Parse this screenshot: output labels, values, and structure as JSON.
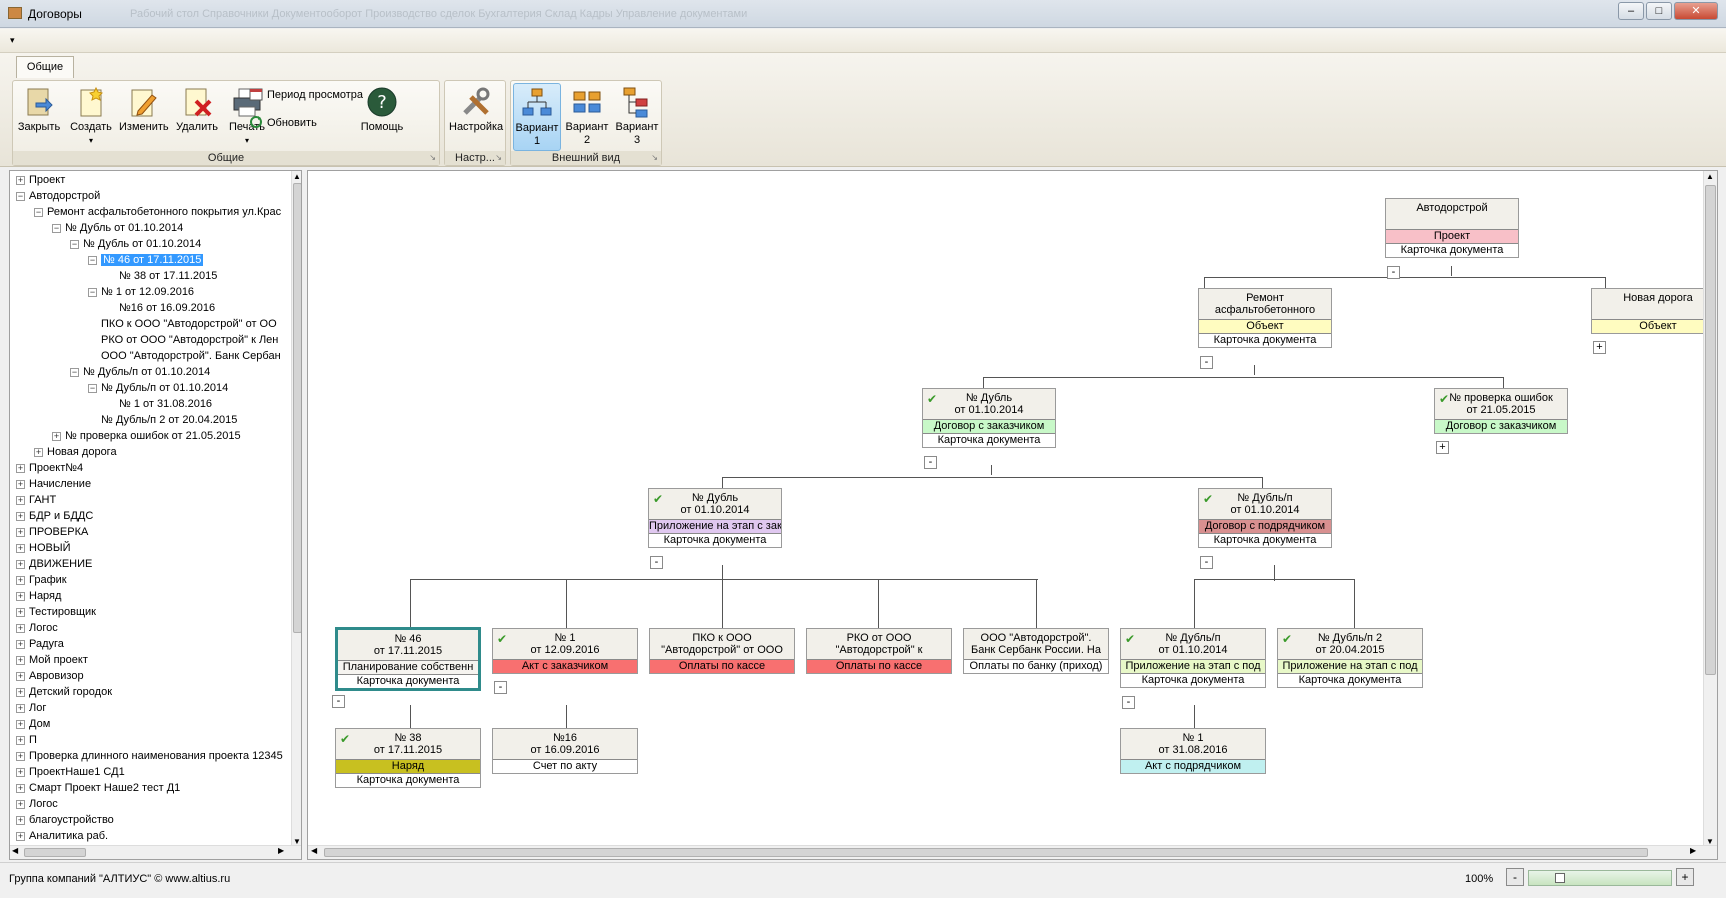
{
  "window": {
    "title": "Договоры",
    "ghost_tabs": "Рабочий стол   Справочники   Документооборот   Производство сделок   Бухгалтерия   Склад   Кадры   Управление документами"
  },
  "ribbon": {
    "tab": "Общие",
    "buttons": {
      "close": "Закрыть",
      "create": "Создать",
      "edit": "Изменить",
      "delete": "Удалить",
      "print": "Печать",
      "period": "Период просмотра",
      "refresh": "Обновить",
      "help": "Помощь",
      "settings": "Настройка",
      "variant1": "Вариант 1",
      "variant2": "Вариант 2",
      "variant3": "Вариант 3"
    },
    "groups": {
      "general": "Общие",
      "settings": "Настр...",
      "appearance": "Внешний вид"
    }
  },
  "tree": [
    {
      "label": "Проект",
      "depth": 0,
      "toggle": "+"
    },
    {
      "label": "Автодорстрой",
      "depth": 0,
      "toggle": "-"
    },
    {
      "label": "Ремонт асфальтобетонного покрытия ул.Крас",
      "depth": 1,
      "toggle": "-"
    },
    {
      "label": "№ Дубль  от 01.10.2014",
      "depth": 2,
      "toggle": "-"
    },
    {
      "label": "№ Дубль  от 01.10.2014",
      "depth": 3,
      "toggle": "-"
    },
    {
      "label": "№ 46  от 17.11.2015",
      "depth": 4,
      "toggle": "-",
      "selected": true
    },
    {
      "label": "№ 38 от 17.11.2015",
      "depth": 5,
      "toggle": ""
    },
    {
      "label": "№ 1 от 12.09.2016",
      "depth": 4,
      "toggle": "-"
    },
    {
      "label": "№16 от 16.09.2016",
      "depth": 5,
      "toggle": ""
    },
    {
      "label": "ПКО к ООО \"Автодорстрой\" от ОО",
      "depth": 4,
      "toggle": ""
    },
    {
      "label": "РКО от ООО \"Автодорстрой\" к Лен",
      "depth": 4,
      "toggle": ""
    },
    {
      "label": "ООО \"Автодорстрой\". Банк Сербан",
      "depth": 4,
      "toggle": ""
    },
    {
      "label": "№ Дубль/п  от 01.10.2014",
      "depth": 3,
      "toggle": "-"
    },
    {
      "label": "№ Дубль/п  от 01.10.2014",
      "depth": 4,
      "toggle": "-"
    },
    {
      "label": "№ 1 от 31.08.2016",
      "depth": 5,
      "toggle": ""
    },
    {
      "label": "№ Дубль/п 2  от 20.04.2015",
      "depth": 4,
      "toggle": ""
    },
    {
      "label": "№ проверка ошибок  от 21.05.2015",
      "depth": 2,
      "toggle": "+"
    },
    {
      "label": "Новая дорога",
      "depth": 1,
      "toggle": "+"
    },
    {
      "label": "Проект№4",
      "depth": 0,
      "toggle": "+"
    },
    {
      "label": "Начисление",
      "depth": 0,
      "toggle": "+"
    },
    {
      "label": "ГАНТ",
      "depth": 0,
      "toggle": "+"
    },
    {
      "label": "БДР и БДДС",
      "depth": 0,
      "toggle": "+"
    },
    {
      "label": "ПРОВЕРКА",
      "depth": 0,
      "toggle": "+"
    },
    {
      "label": "НОВЫЙ",
      "depth": 0,
      "toggle": "+"
    },
    {
      "label": "ДВИЖЕНИЕ",
      "depth": 0,
      "toggle": "+"
    },
    {
      "label": "График",
      "depth": 0,
      "toggle": "+"
    },
    {
      "label": "Наряд",
      "depth": 0,
      "toggle": "+"
    },
    {
      "label": "Тестировщик",
      "depth": 0,
      "toggle": "+"
    },
    {
      "label": "Логос",
      "depth": 0,
      "toggle": "+"
    },
    {
      "label": "Радуга",
      "depth": 0,
      "toggle": "+"
    },
    {
      "label": "Мой проект",
      "depth": 0,
      "toggle": "+"
    },
    {
      "label": "Авровизор",
      "depth": 0,
      "toggle": "+"
    },
    {
      "label": "Детский городок",
      "depth": 0,
      "toggle": "+"
    },
    {
      "label": "Лог",
      "depth": 0,
      "toggle": "+"
    },
    {
      "label": "Дом",
      "depth": 0,
      "toggle": "+"
    },
    {
      "label": "П",
      "depth": 0,
      "toggle": "+"
    },
    {
      "label": "Проверка длинного наименования проекта 12345",
      "depth": 0,
      "toggle": "+"
    },
    {
      "label": "ПроектНаше1 СД1",
      "depth": 0,
      "toggle": "+"
    },
    {
      "label": "Смарт Проект Наше2 тест Д1",
      "depth": 0,
      "toggle": "+"
    },
    {
      "label": "Логос",
      "depth": 0,
      "toggle": "+"
    },
    {
      "label": "благоустройство",
      "depth": 0,
      "toggle": "+"
    },
    {
      "label": "Аналитика раб.",
      "depth": 0,
      "toggle": "+"
    }
  ],
  "nodes": [
    {
      "id": "n-root",
      "title": "Автодорстрой",
      "type": "Проект",
      "type_color": "#f8c0c8",
      "card": "Карточка документа",
      "check": false,
      "toggle": "-"
    },
    {
      "id": "n-obj1",
      "title": "Ремонт\nасфальтобетонного",
      "type": "Объект",
      "type_color": "#fffcc0",
      "card": "Карточка документа",
      "check": false,
      "toggle": "-"
    },
    {
      "id": "n-obj2",
      "title": "Новая дорога",
      "type": "Объект",
      "type_color": "#fffcc0",
      "card": "",
      "check": false,
      "toggle": "+"
    },
    {
      "id": "n-d1",
      "title": "№ Дубль\nот 01.10.2014",
      "type": "Договор с заказчиком",
      "type_color": "#c8f8c8",
      "card": "Карточка документа",
      "check": true,
      "toggle": "-"
    },
    {
      "id": "n-d2",
      "title": "№ проверка ошибок\nот 21.05.2015",
      "type": "Договор с заказчиком",
      "type_color": "#c8f8c8",
      "card": "",
      "check": true,
      "toggle": "+"
    },
    {
      "id": "n-d3",
      "title": "№ Дубль\nот 01.10.2014",
      "type": "Приложение на этап  с зак",
      "type_color": "#e0c8f0",
      "card": "Карточка документа",
      "check": true,
      "toggle": "-"
    },
    {
      "id": "n-d4",
      "title": "№ Дубль/п\nот 01.10.2014",
      "type": "Договор с подрядчиком",
      "type_color": "#d89090",
      "card": "Карточка документа",
      "check": true,
      "toggle": "-"
    },
    {
      "id": "n-46",
      "title": "№ 46\nот 17.11.2015",
      "type": "Планирование собственн",
      "type_color": "#f6f4f0",
      "card": "Карточка документа",
      "check": false,
      "toggle": "-",
      "selected": true
    },
    {
      "id": "n-1",
      "title": "№ 1\nот 12.09.2016",
      "type": "Акт с заказчиком",
      "type_color": "#f87070",
      "card": "",
      "check": true,
      "toggle": "-"
    },
    {
      "id": "n-pko",
      "title": "ПКО к ООО\n\"Автодорстрой\" от ООО",
      "type": "Оплаты по кассе",
      "type_color": "#f87070",
      "card": "",
      "check": false,
      "toggle": ""
    },
    {
      "id": "n-rko",
      "title": "РКО от ООО\n\"Автодорстрой\" к",
      "type": "Оплаты по кассе",
      "type_color": "#f87070",
      "card": "",
      "check": false,
      "toggle": ""
    },
    {
      "id": "n-bank",
      "title": "ООО \"Автодорстрой\".\nБанк Сербанк России. На",
      "type": "Оплаты по банку (приход)",
      "type_color": "#ffffff",
      "card": "",
      "check": false,
      "toggle": ""
    },
    {
      "id": "n-dp1",
      "title": "№ Дубль/п\nот 01.10.2014",
      "type": "Приложение на этап  с под",
      "type_color": "#e8f8c8",
      "card": "Карточка документа",
      "check": true,
      "toggle": "-"
    },
    {
      "id": "n-dp2",
      "title": "№ Дубль/п 2\nот 20.04.2015",
      "type": "Приложение на этап  с под",
      "type_color": "#e8f8c8",
      "card": "Карточка документа",
      "check": true,
      "toggle": ""
    },
    {
      "id": "n-38",
      "title": "№ 38\nот 17.11.2015",
      "type": "Наряд",
      "type_color": "#c8c020",
      "card": "Карточка документа",
      "check": true,
      "toggle": ""
    },
    {
      "id": "n-16",
      "title": "№16\nот 16.09.2016",
      "type": "Счет по акту",
      "type_color": "#ffffff",
      "card": "",
      "check": false,
      "toggle": ""
    },
    {
      "id": "n-1b",
      "title": "№ 1\nот 31.08.2016",
      "type": "Акт с подрядчиком",
      "type_color": "#c0f0f0",
      "card": "",
      "check": false,
      "toggle": ""
    }
  ],
  "status": {
    "company": "Группа компаний \"АЛТИУС\" © www.altius.ru",
    "zoom": "100%"
  },
  "colors": {
    "selection": "#3399ff",
    "accent": "#2f8b8b"
  }
}
